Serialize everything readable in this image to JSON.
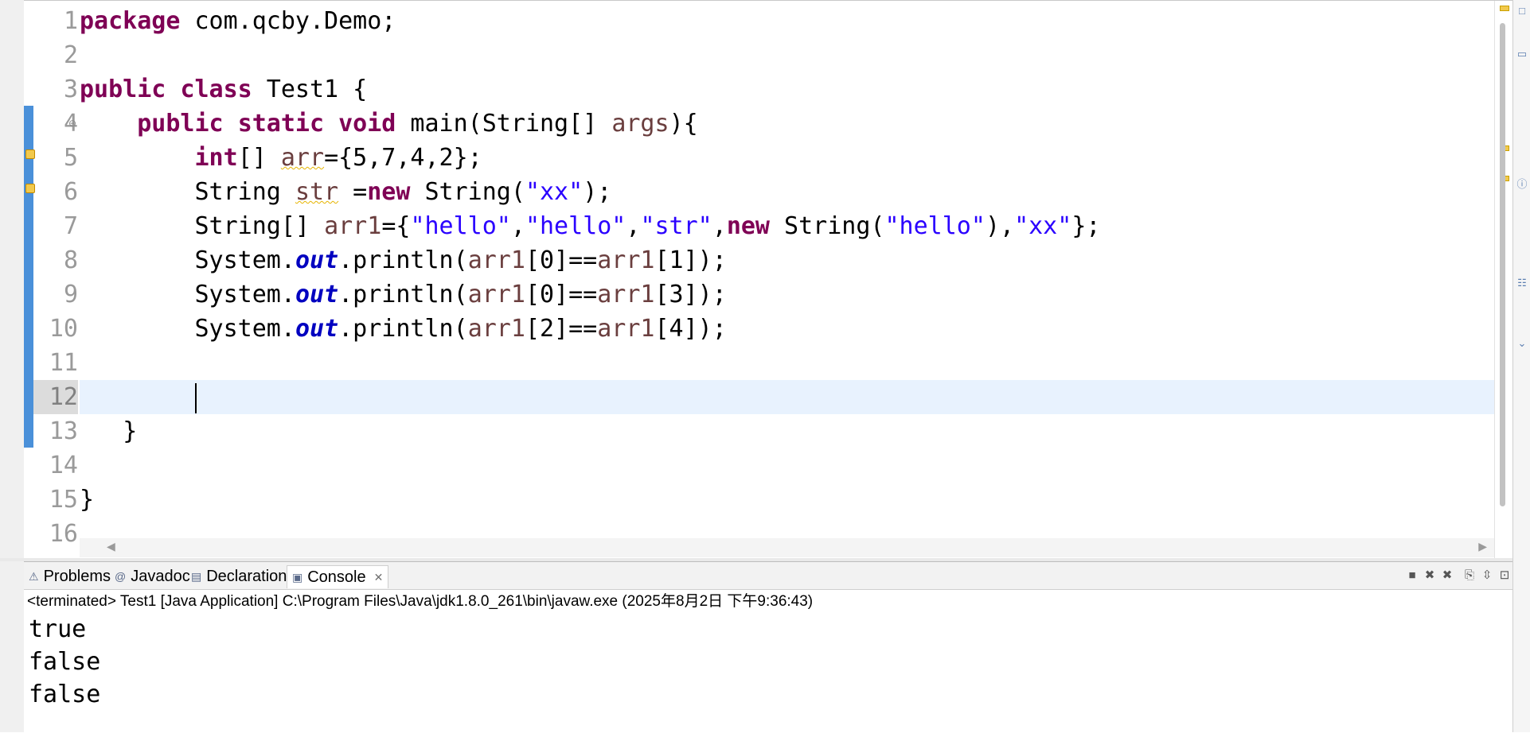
{
  "editor": {
    "line_numbers": [
      "1",
      "2",
      "3",
      "4",
      "5",
      "6",
      "7",
      "8",
      "9",
      "10",
      "11",
      "12",
      "13",
      "14",
      "15",
      "16"
    ],
    "current_line_index": 11,
    "tokens": {
      "l1_kw": "package",
      "l1_rest": " com.qcby.Demo;",
      "l3_kw1": "public",
      "l3_kw2": "class",
      "l3_rest": " Test1 {",
      "l4_kw1": "public",
      "l4_kw2": "static",
      "l4_kw3": "void",
      "l4_rest1": " main(String[] ",
      "l4_var": "args",
      "l4_rest2": "){",
      "l5_kw": "int",
      "l5_rest1": "[] ",
      "l5_var": "arr",
      "l5_rest2": "={5,7,4,2};",
      "l6_rest1": "String ",
      "l6_var": "str",
      "l6_rest2": " =",
      "l6_kw": "new",
      "l6_rest3": " String(",
      "l6_str": "\"xx\"",
      "l6_rest4": ");",
      "l7_rest1": "String[] ",
      "l7_var": "arr1",
      "l7_rest2": "={",
      "l7_s1": "\"hello\"",
      "comma": ",",
      "l7_s2": "\"hello\"",
      "l7_s3": "\"str\"",
      "l7_kw": "new",
      "l7_rest3": " String(",
      "l7_s4": "\"hello\"",
      "l7_rest4": "),",
      "l7_s5": "\"xx\"",
      "l7_rest5": "};",
      "sys": "System.",
      "out": "out",
      "println": ".println(",
      "arr1": "arr1",
      "l8_mid1": "[0]==",
      "l8_mid2": "[1]);",
      "l9_mid1": "[0]==",
      "l9_mid2": "[3]);",
      "l10_mid1": "[2]==",
      "l10_mid2": "[4]);",
      "l13": "}",
      "l15": "}"
    }
  },
  "console": {
    "tabs": [
      {
        "label": "Problems",
        "icon": "problems-icon"
      },
      {
        "label": "Javadoc",
        "icon": "javadoc-icon"
      },
      {
        "label": "Declaration",
        "icon": "declaration-icon"
      },
      {
        "label": "Console",
        "icon": "console-icon"
      }
    ],
    "status": "<terminated> Test1 [Java Application] C:\\Program Files\\Java\\jdk1.8.0_261\\bin\\javaw.exe  (2025年8月2日 下午9:36:43)",
    "output": [
      "true",
      "false",
      "false"
    ]
  },
  "colors": {
    "keyword": "#7f0055",
    "string": "#2a00ff",
    "static_field": "#0000c0",
    "local_variable": "#6a3e3e",
    "current_line": "#e8f2fe"
  }
}
